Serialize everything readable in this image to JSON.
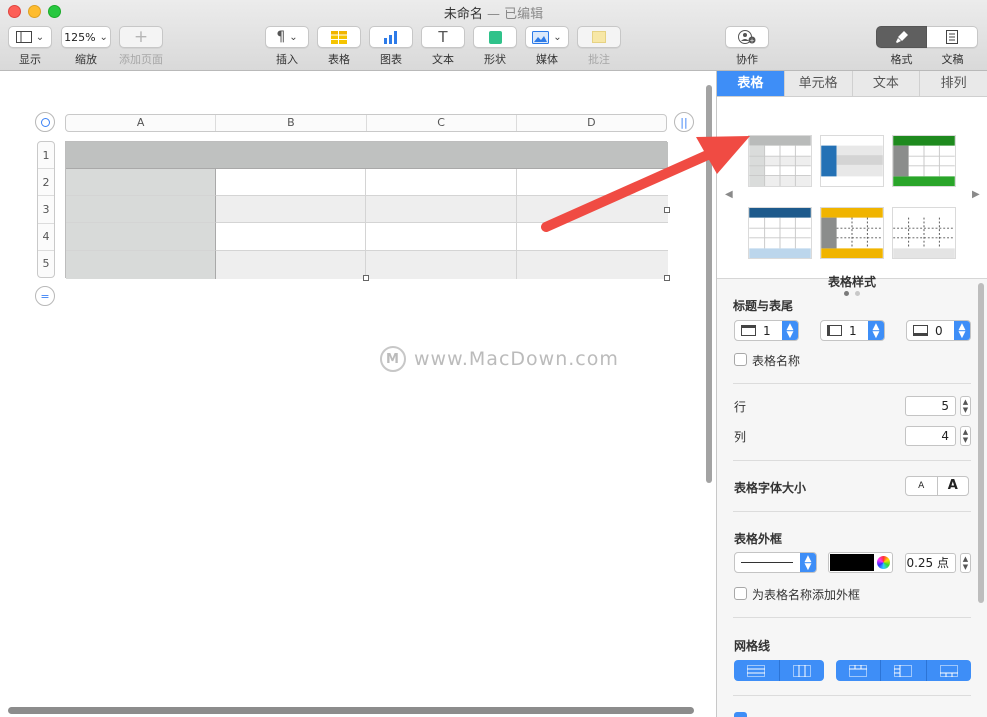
{
  "window": {
    "title": "未命名",
    "title_sep": " — ",
    "title_status": "已编辑"
  },
  "toolbar": {
    "view_label": "显示",
    "zoom_value": "125%",
    "zoom_label": "缩放",
    "add_page_label": "添加页面",
    "insert_label": "插入",
    "table_label": "表格",
    "chart_label": "图表",
    "text_label": "文本",
    "shape_label": "形状",
    "media_label": "媒体",
    "comment_label": "批注",
    "collaborate_label": "协作",
    "format_label": "格式",
    "document_label": "文稿"
  },
  "sheet": {
    "columns": [
      "A",
      "B",
      "C",
      "D"
    ],
    "rows": [
      "1",
      "2",
      "3",
      "4",
      "5"
    ]
  },
  "watermark": {
    "text": "www.MacDown.com",
    "logo": "M"
  },
  "inspector": {
    "tabs": [
      "表格",
      "单元格",
      "文本",
      "排列"
    ],
    "active_tab": "表格",
    "styles_label": "表格样式",
    "header_footer": {
      "title": "标题与表尾",
      "header_rows": "1",
      "header_cols": "1",
      "footer_rows": "0"
    },
    "table_name_checkbox": "表格名称",
    "rows_label": "行",
    "rows_value": "5",
    "cols_label": "列",
    "cols_value": "4",
    "font_size_label": "表格字体大小",
    "font_small": "A",
    "font_large": "A",
    "outline_title": "表格外框",
    "outline_width": "0.25 点",
    "outline_name_checkbox": "为表格名称添加外框",
    "gridlines_title": "网格线",
    "colors": {
      "accent": "#3e8ef7",
      "outline_color": "#000000"
    }
  }
}
